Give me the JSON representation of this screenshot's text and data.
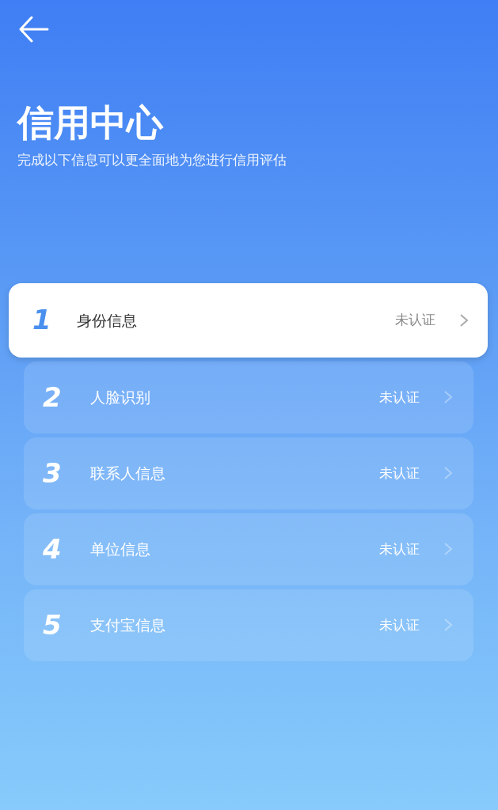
{
  "title": "信用中心",
  "subtitle": "完成以下信息可以更全面地为您进行信用评估",
  "items": [
    {
      "number": "1",
      "label": "身份信息",
      "status": "未认证",
      "selected": true
    },
    {
      "number": "2",
      "label": "人脸识别",
      "status": "未认证",
      "selected": false
    },
    {
      "number": "3",
      "label": "联系人信息",
      "status": "未认证",
      "selected": false
    },
    {
      "number": "4",
      "label": "单位信息",
      "status": "未认证",
      "selected": false
    },
    {
      "number": "5",
      "label": "支付宝信息",
      "status": "未认证",
      "selected": false
    }
  ]
}
